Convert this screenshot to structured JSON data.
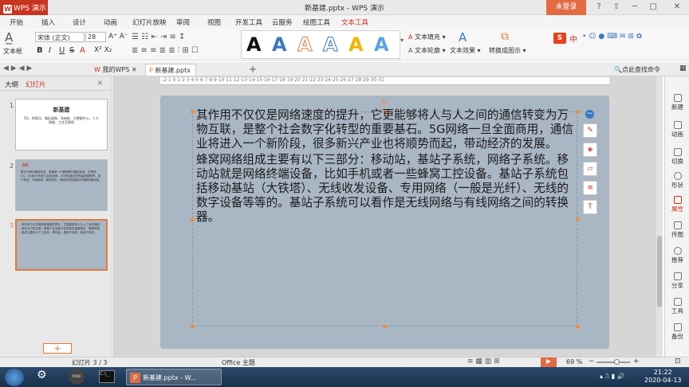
{
  "titlebar": {
    "app_name": "WPS 演示",
    "window_title": "新基建.pptx - WPS 演示",
    "login": "未登录",
    "controls": [
      "?",
      "⇧",
      "─",
      "□",
      "✕"
    ]
  },
  "menu": {
    "tabs": [
      "开始",
      "插入",
      "设计",
      "动画",
      "幻灯片放映",
      "审阅",
      "视图",
      "开发工具",
      "云服务",
      "绘图工具",
      "文本工具"
    ]
  },
  "ribbon": {
    "textbox_label": "文本框",
    "font_name": "宋体 (正文)",
    "font_size": "28",
    "text_fill": "文本填充",
    "text_outline": "文本轮廓",
    "text_effect": "文本效果",
    "convert_label": "转换成图示",
    "search_placeholder": "中"
  },
  "doctabs": {
    "tabs": [
      "我的WPS",
      "新基建.pptx"
    ],
    "right_action": "点此查找命令"
  },
  "leftpanel": {
    "tabs": [
      "大纲",
      "幻灯片"
    ],
    "slides": [
      {
        "num": "1",
        "title": "新基建",
        "subtitle": "5G、特高压、城际高铁、充电桩、大数据中心、人工智能、工业互联网"
      },
      {
        "num": "2",
        "heading": "5G",
        "body": "第五代移动通信技术，是最新一代蜂窝移动通信技术，也是继4G、3G和2G系统之后的延伸。5G的性能目标是高数据速率、减少延迟、节省能源、降低成本、提高系统容量和大规模设备连接。"
      },
      {
        "num": "3",
        "body": "其作用不仅仅是网络速度的提升，它更能够将人与人之间的通信转变为万物互联，是整个社会数字化转型的重要基石。蜂窝网络组成主要有以下三部分：移动站，基站子系统，网络子系统。"
      }
    ]
  },
  "slide": {
    "paragraphs": [
      "其作用不仅仅是网络速度的提升，它更能够将人与人之间的通信转变为万物互联，是整个社会数字化转型的重要基石。5G网络一旦全面商用，通信业将进入一个新阶段，很多新兴产业也将顺势而起，带动经济的发展。",
      "蜂窝网络组成主要有以下三部分：移动站，基站子系统，网络子系统。移动站就是网络终端设备，比如手机或者一些蜂窝工控设备。基站子系统包括移动基站（大铁塔）、无线收发设备、专用网络（一般是光纤）、无线的数字设备等等的。基站子系统可以看作是无线网络与有线网络之间的转换器。"
    ]
  },
  "rightpane": {
    "items": [
      "新建",
      "动画",
      "切换",
      "形状",
      "属性",
      "传图",
      "推荐",
      "分享",
      "工具",
      "备份"
    ]
  },
  "statusbar": {
    "slide_info": "幻灯片 3 / 3",
    "theme": "Office 主题",
    "zoom": "69 %"
  },
  "taskbar": {
    "active_window": "新基建.pptx - W...",
    "time": "21:22",
    "date": "2020-04-13"
  },
  "colors": {
    "accent": "#c8341f",
    "slide_bg": "#a9b6c4",
    "orange": "#e07b3d"
  }
}
